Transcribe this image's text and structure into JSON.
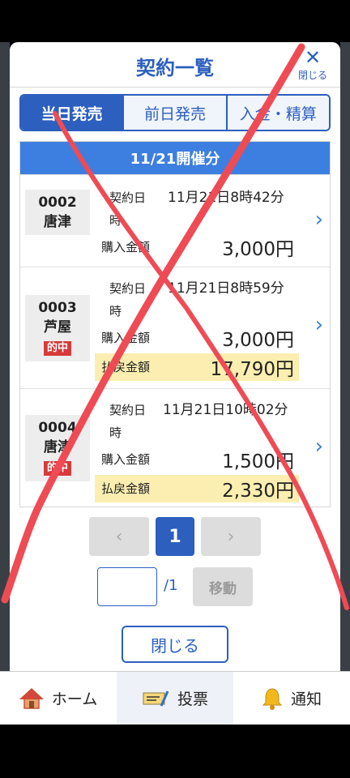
{
  "modal": {
    "title": "契約一覧",
    "close_x_label": "閉じる",
    "tabs": [
      "当日発売",
      "前日発売",
      "入金・精算"
    ],
    "list_header": "11/21開催分",
    "rows": [
      {
        "id": "0002",
        "venue": "唐津",
        "contract_label": "契約日時",
        "contract_date": "11月21日8時42分",
        "purchase_label": "購入金額",
        "purchase": "3,000円"
      },
      {
        "id": "0003",
        "venue": "芦屋",
        "badge": "的中",
        "contract_label": "契約日時",
        "contract_date": "11月21日8時59分",
        "purchase_label": "購入金額",
        "purchase": "3,000円",
        "payout_label": "払戻金額",
        "payout": "17,790円"
      },
      {
        "id": "0004",
        "venue": "唐津",
        "badge": "的中",
        "contract_label": "契約日時",
        "contract_date": "11月21日10時02分",
        "purchase_label": "購入金額",
        "purchase": "1,500円",
        "payout_label": "払戻金額",
        "payout": "2,330円"
      }
    ],
    "pager": {
      "prev": "‹",
      "current": "1",
      "next": "›"
    },
    "jump": {
      "input_value": "",
      "total": "/1",
      "move_label": "移動"
    },
    "close_button": "閉じる"
  },
  "nav": [
    {
      "label": "ホーム",
      "icon": "home-icon"
    },
    {
      "label": "投票",
      "icon": "ticket-icon"
    },
    {
      "label": "通知",
      "icon": "bell-icon"
    }
  ],
  "colors": {
    "accent": "#2c5fbe",
    "header_blue": "#3c7fe0",
    "hit_red": "#d8393a",
    "payout_bg": "#fbeeb0",
    "annotation_red": "#ef4b55"
  }
}
